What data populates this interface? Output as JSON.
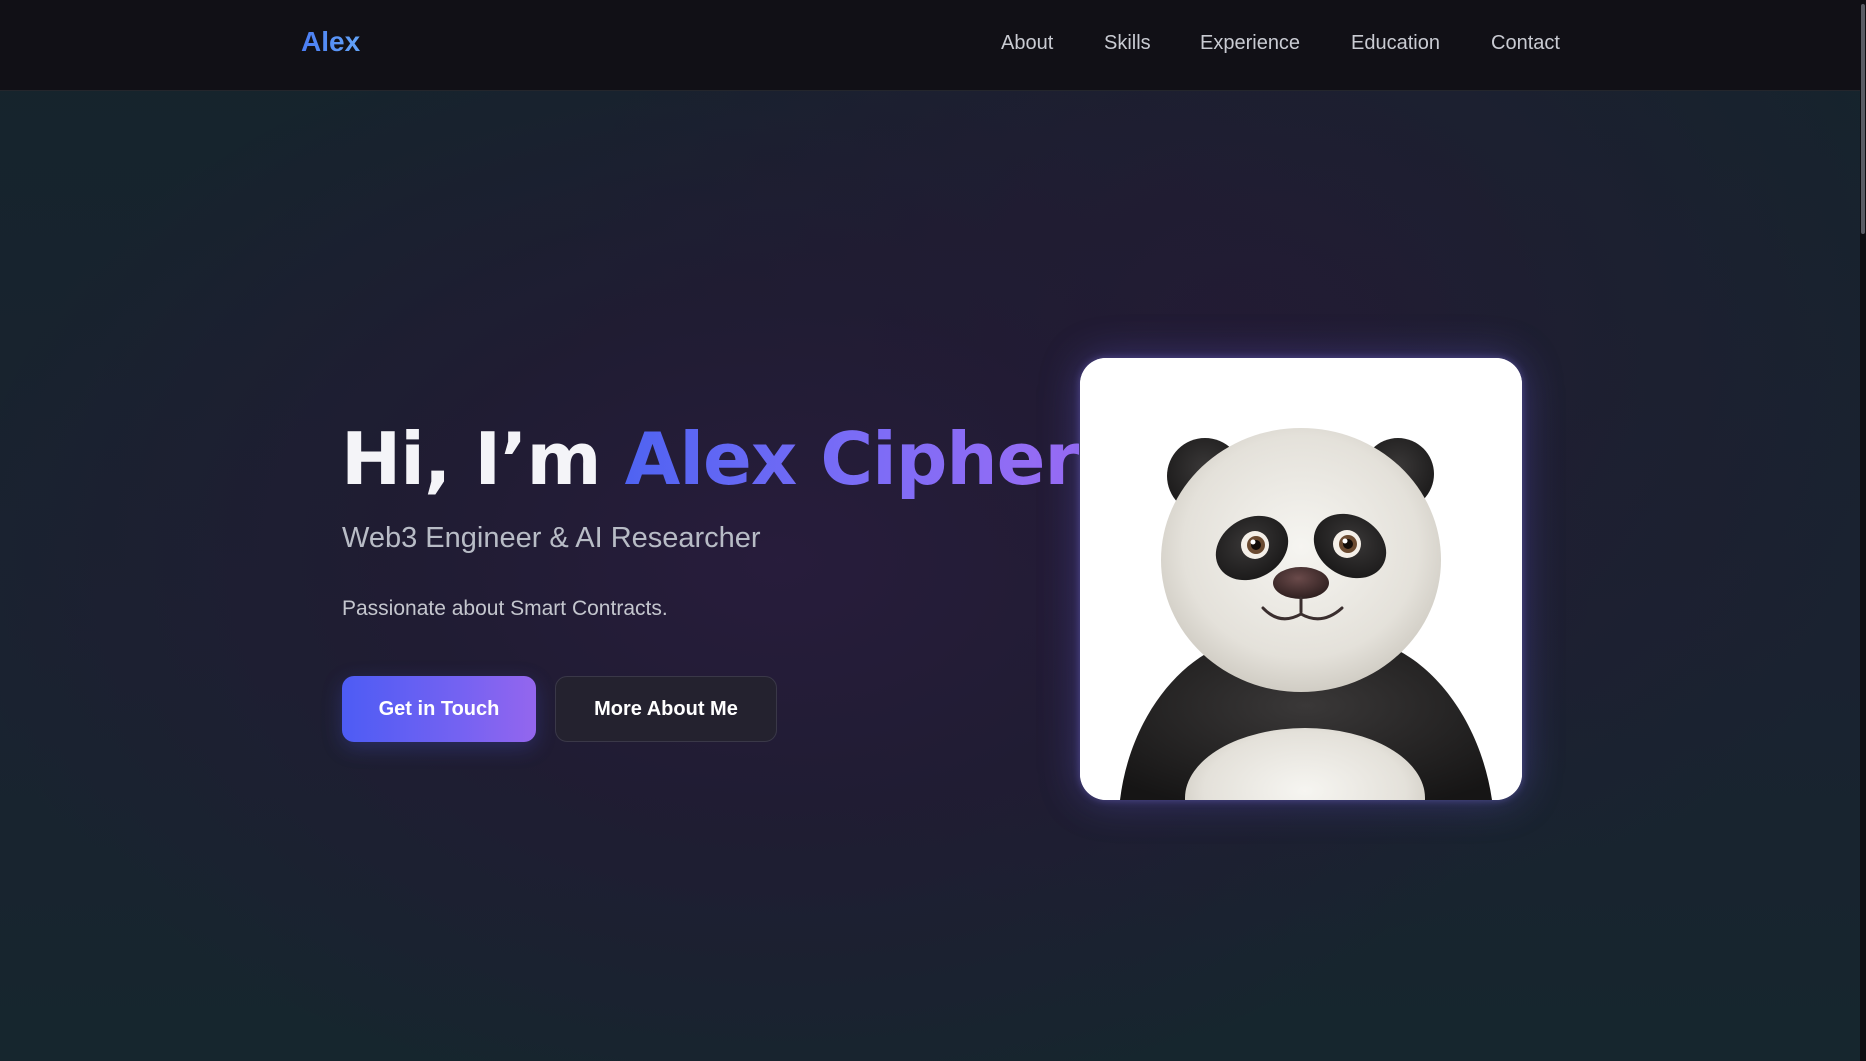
{
  "nav": {
    "logo": "Alex",
    "links": [
      "About",
      "Skills",
      "Experience",
      "Education",
      "Contact"
    ]
  },
  "hero": {
    "greeting": "Hi, I’m ",
    "name": "Alex Cipher",
    "subtitle": "Web3 Engineer & AI Researcher",
    "tagline": "Passionate about Smart Contracts.",
    "primary_button": "Get in Touch",
    "secondary_button": "More About Me",
    "avatar_icon": "panda-avatar"
  },
  "colors": {
    "background": "#13222a",
    "navbar": "#111016",
    "logo": "#5b8ef6",
    "accent_start": "#4f63f2",
    "accent_end": "#9a6cf4",
    "secondary_button": "#24222f"
  }
}
